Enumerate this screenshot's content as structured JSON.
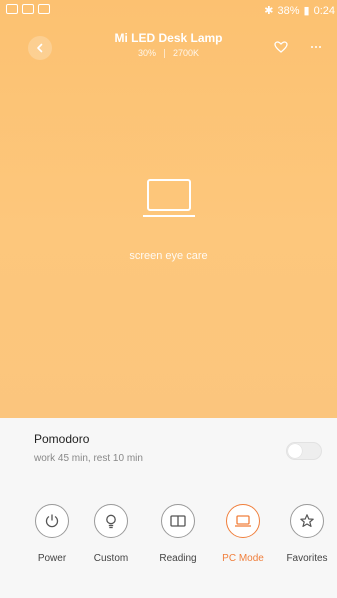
{
  "status_bar": {
    "battery": "38%",
    "time": "0:24"
  },
  "header": {
    "title": "Mi LED Desk Lamp",
    "brightness": "30%",
    "color_temp": "2700K"
  },
  "hero": {
    "mode_label": "screen eye care",
    "icon": "laptop-icon"
  },
  "pomodoro": {
    "title": "Pomodoro",
    "subtitle": "work 45 min, rest 10 min",
    "enabled": false
  },
  "modes": [
    {
      "label": "Power",
      "icon": "power-icon",
      "active": false
    },
    {
      "label": "Custom",
      "icon": "bulb-icon",
      "active": false
    },
    {
      "label": "Reading",
      "icon": "book-icon",
      "active": false
    },
    {
      "label": "PC Mode",
      "icon": "laptop-icon",
      "active": true
    },
    {
      "label": "Favorites",
      "icon": "star-icon",
      "active": false
    }
  ],
  "colors": {
    "hero": "#fdc77c",
    "accent": "#f07f3c"
  }
}
